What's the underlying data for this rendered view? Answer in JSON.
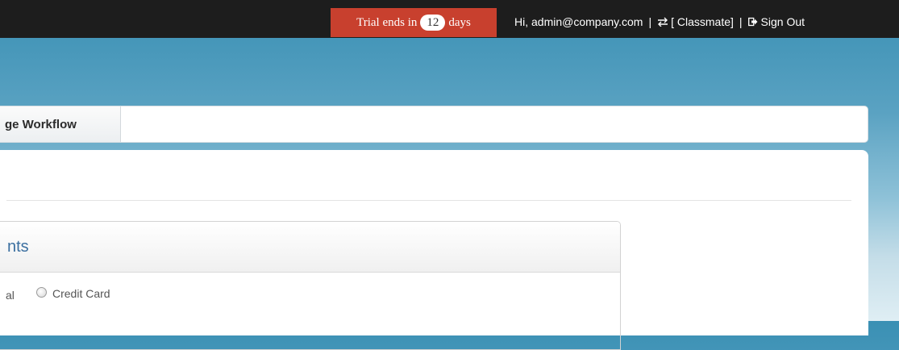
{
  "header": {
    "trial": {
      "prefix": "Trial ends in",
      "count": "12",
      "suffix": "days"
    },
    "greeting": "Hi, admin@company.com",
    "separator": "|",
    "switch_icon": "swap-arrows-icon",
    "switch_label": "[ Classmate]",
    "signout_icon": "sign-out-icon",
    "signout_label": "Sign Out"
  },
  "nav": {
    "items": [
      {
        "label": "ge Workflow"
      }
    ]
  },
  "card": {
    "title": "nts",
    "options": [
      {
        "label": "al"
      },
      {
        "label": "Credit Card",
        "selected": false
      }
    ]
  },
  "colors": {
    "topbar": "#1d1d1d",
    "trial_badge": "#c8402e",
    "card_title": "#3b6fa0"
  }
}
